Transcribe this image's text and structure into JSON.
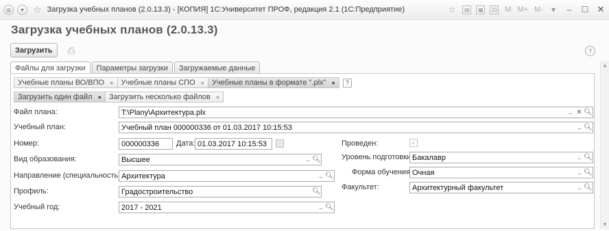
{
  "window": {
    "title": "Загрузка учебных планов (2.0.13.3) - [КОПИЯ] 1С:Университет ПРОФ, редакция 2.1  (1С:Предприятие)",
    "right_labels": {
      "m": "M",
      "mplus": "M+",
      "mminus": "M-"
    }
  },
  "header": {
    "title": "Загрузка учебных планов (2.0.13.3)",
    "load_label": "Загрузить",
    "help_label": "?"
  },
  "tabs": [
    {
      "label": "Файлы для загрузки"
    },
    {
      "label": "Параметры загрузки"
    },
    {
      "label": "Загружаемые данные"
    }
  ],
  "plan_tabs": [
    {
      "label": "Учебные планы ВО/ВПО"
    },
    {
      "label": "Учебные планы СПО"
    },
    {
      "label": "Учебные планы в формате \".plx\""
    }
  ],
  "plan_help_label": "?",
  "mode_tabs": [
    {
      "label": "Загрузить один файл"
    },
    {
      "label": "Загрузить несколько файлов"
    }
  ],
  "form": {
    "file": {
      "label": "Файл плана:",
      "value": "T:\\Plany\\Архитектура.plx"
    },
    "plan": {
      "label": "Учебный план:",
      "value": "Учебный план 000000336 от 01.03.2017 10:15:53"
    },
    "number": {
      "label": "Номер:",
      "value": "000000336"
    },
    "date": {
      "label": "Дата:",
      "value": "01.03.2017 10:15:53"
    },
    "edu_type": {
      "label": "Вид образования:",
      "value": "Высшее"
    },
    "direction": {
      "label": "Направление (специальность):",
      "value": "Архитектура"
    },
    "profile": {
      "label": "Профиль:",
      "value": "Градостроительство"
    },
    "year": {
      "label": "Учебный год:",
      "value": "2017 - 2021"
    },
    "posted": {
      "label": "Проведен:",
      "checked": true
    },
    "level": {
      "label": "Уровень подготовки:",
      "value": "Бакалавр"
    },
    "form_type": {
      "label": "Форма обучения:",
      "value": "Очная"
    },
    "faculty": {
      "label": "Факультет:",
      "value": "Архитектурный факультет"
    }
  }
}
